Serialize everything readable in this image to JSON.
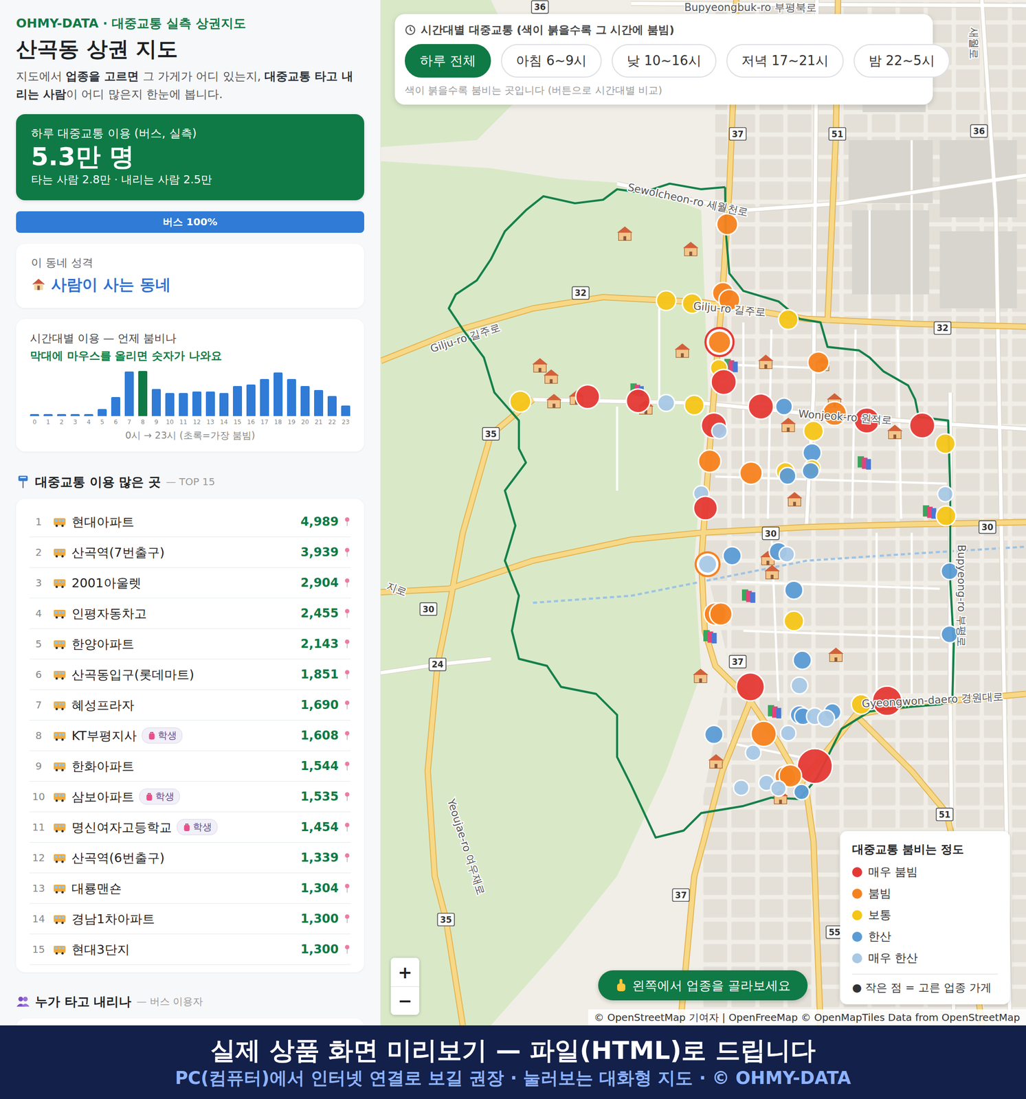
{
  "sidebar": {
    "brand": "OHMY-DATA · 대중교통 실측 상권지도",
    "title": "산곡동 상권 지도",
    "description": [
      {
        "text": "지도에서 ",
        "bold": false
      },
      {
        "text": "업종을 고르면",
        "bold": true
      },
      {
        "text": " 그 가게가 어디 있는지, ",
        "bold": false
      },
      {
        "text": "대중교통 타고 내리는 사람",
        "bold": true
      },
      {
        "text": "이 어디 많은지 한눈에 봅니다.",
        "bold": false
      }
    ],
    "summary": {
      "label": "하루 대중교통 이용 (버스, 실측)",
      "value": "5.3만 명",
      "sub": "타는 사람 2.8만 · 내리는 사람 2.5만"
    },
    "mode_bar": {
      "label": "버스 100%",
      "level": 1
    },
    "character": {
      "label": "이 동네 성격",
      "value": "사람이 사는 동네"
    },
    "chart": {
      "title": "시간대별 이용 — 언제 붐비나",
      "hint": "막대에 마우스를 올리면 숫자가 나와요",
      "labels": [
        "0",
        "1",
        "2",
        "3",
        "4",
        "5",
        "6",
        "7",
        "8",
        "9",
        "10",
        "11",
        "12",
        "13",
        "14",
        "15",
        "16",
        "17",
        "18",
        "19",
        "20",
        "21",
        "22",
        "23"
      ],
      "values": [
        200,
        200,
        200,
        200,
        200,
        700,
        1860,
        4420,
        4450,
        2690,
        2280,
        2280,
        2420,
        2420,
        2280,
        2970,
        3110,
        3660,
        4280,
        3660,
        2970,
        2550,
        2000,
        1040
      ],
      "highlight": 8,
      "caption": "0시 → 23시 (초록=가장 붐빔)"
    },
    "top_list": {
      "title": "대중교통 이용 많은 곳",
      "subtitle": "— TOP 15",
      "items": [
        {
          "rank": "1",
          "name": "현대아파트",
          "count": "4,989",
          "tag": ""
        },
        {
          "rank": "2",
          "name": "산곡역(7번출구)",
          "count": "3,939",
          "tag": ""
        },
        {
          "rank": "3",
          "name": "2001아울렛",
          "count": "2,904",
          "tag": ""
        },
        {
          "rank": "4",
          "name": "인평자동차고",
          "count": "2,455",
          "tag": ""
        },
        {
          "rank": "5",
          "name": "한양아파트",
          "count": "2,143",
          "tag": ""
        },
        {
          "rank": "6",
          "name": "산곡동입구(롯데마트)",
          "count": "1,851",
          "tag": ""
        },
        {
          "rank": "7",
          "name": "혜성프라자",
          "count": "1,690",
          "tag": ""
        },
        {
          "rank": "8",
          "name": "KT부평지사",
          "count": "1,608",
          "tag": "학생"
        },
        {
          "rank": "9",
          "name": "한화아파트",
          "count": "1,544",
          "tag": ""
        },
        {
          "rank": "10",
          "name": "삼보아파트",
          "count": "1,535",
          "tag": "학생"
        },
        {
          "rank": "11",
          "name": "명신여자고등학교",
          "count": "1,454",
          "tag": "학생"
        },
        {
          "rank": "12",
          "name": "산곡역(6번출구)",
          "count": "1,339",
          "tag": ""
        },
        {
          "rank": "13",
          "name": "대룡맨숀",
          "count": "1,304",
          "tag": ""
        },
        {
          "rank": "14",
          "name": "경남1차아파트",
          "count": "1,300",
          "tag": ""
        },
        {
          "rank": "15",
          "name": "현대3단지",
          "count": "1,300",
          "tag": ""
        }
      ]
    },
    "next_section": {
      "title": "누가 타고 내리나",
      "subtitle": "— 버스 이용자"
    }
  },
  "time_filter": {
    "title": "시간대별 대중교통 (색이 붉을수록 그 시간에 붐빔)",
    "hint": "색이 붉을수록 붐비는 곳입니다 (버튼으로 시간대별 비교)",
    "options": [
      {
        "label": "하루 전체",
        "selected": true
      },
      {
        "label": "아침 6~9시",
        "selected": false
      },
      {
        "label": "낮 10~16시",
        "selected": false
      },
      {
        "label": "저녁 17~21시",
        "selected": false
      },
      {
        "label": "밤 22~5시",
        "selected": false
      }
    ]
  },
  "legend": {
    "title": "대중교통 붐비는 정도",
    "items": [
      {
        "label": "매우 붐빔",
        "color": "#e53935"
      },
      {
        "label": "붐빔",
        "color": "#f5821f"
      },
      {
        "label": "보통",
        "color": "#f5c518"
      },
      {
        "label": "한산",
        "color": "#5b9bd5"
      },
      {
        "label": "매우 한산",
        "color": "#a8c8e6"
      }
    ],
    "note": "● 작은 점 = 고른 업종 가게"
  },
  "zoom": {
    "in": "+",
    "out": "−"
  },
  "prompt": "왼쪽에서 업종을 골라보세요",
  "attribution": "© OpenStreetMap 기여자 | OpenFreeMap © OpenMapTiles Data from OpenStreetMap",
  "map": {
    "road_labels": [
      "Bupyeongbuk-ro 부평북로",
      "Sewolcheon-ro 세월천로",
      "Gilju-ro 길주로",
      "Gilju-ro 길주로",
      "Wonjeok-ro 원적로",
      "Gyeongwon-daero 경원대로",
      "Yeoujae-ro 여우재로",
      "Bupyeong-ro 부평로",
      "지로",
      "새월로"
    ],
    "shields": [
      "36",
      "36",
      "37",
      "51",
      "32",
      "32",
      "35",
      "30",
      "30",
      "30",
      "24",
      "37",
      "37",
      "35",
      "51",
      "55"
    ],
    "stops": [
      {
        "color": "#f5821f"
      },
      {
        "color": "#f5821f"
      },
      {
        "color": "#f5821f"
      },
      {
        "color": "#f5c518"
      },
      {
        "color": "#f5c518"
      },
      {
        "color": "#f5c518"
      },
      {
        "color": "#f5821f",
        "ring": "#e53935"
      },
      {
        "color": "#f5c518"
      },
      {
        "color": "#e53935"
      },
      {
        "color": "#e53935"
      },
      {
        "color": "#e53935"
      },
      {
        "color": "#f5c518"
      },
      {
        "color": "#a8c8e6"
      },
      {
        "color": "#f5c518"
      },
      {
        "color": "#e53935"
      },
      {
        "color": "#5b9bd5"
      },
      {
        "color": "#f5821f"
      },
      {
        "color": "#f5821f"
      },
      {
        "color": "#e53935"
      },
      {
        "color": "#e53935"
      },
      {
        "color": "#e53935"
      },
      {
        "color": "#a8c8e6"
      },
      {
        "color": "#f5c518"
      },
      {
        "color": "#f5c518"
      },
      {
        "color": "#5b9bd5"
      },
      {
        "color": "#f5821f"
      },
      {
        "color": "#f5821f"
      },
      {
        "color": "#f5c518"
      },
      {
        "color": "#5b9bd5"
      },
      {
        "color": "#f5c518"
      },
      {
        "color": "#5b9bd5"
      },
      {
        "color": "#a8c8e6"
      },
      {
        "color": "#a8c8e6"
      },
      {
        "color": "#e53935"
      },
      {
        "color": "#f5c518"
      },
      {
        "color": "#5b9bd5"
      },
      {
        "color": "#a8c8e6"
      },
      {
        "color": "#5b9bd5"
      },
      {
        "color": "#a8c8e6",
        "ring": "#f5821f"
      },
      {
        "color": "#5b9bd5"
      },
      {
        "color": "#5b9bd5"
      },
      {
        "color": "#5b9bd5"
      },
      {
        "color": "#f5821f"
      },
      {
        "color": "#f5821f"
      },
      {
        "color": "#f5c518"
      },
      {
        "color": "#5b9bd5"
      },
      {
        "color": "#a8c8e6"
      },
      {
        "color": "#e53935"
      },
      {
        "color": "#f5c518"
      },
      {
        "color": "#e53935"
      },
      {
        "color": "#5b9bd5"
      },
      {
        "color": "#5b9bd5"
      },
      {
        "color": "#5b9bd5"
      },
      {
        "color": "#a8c8e6"
      },
      {
        "color": "#a8c8e6"
      },
      {
        "color": "#5b9bd5"
      },
      {
        "color": "#f5821f"
      },
      {
        "color": "#a8c8e6"
      },
      {
        "color": "#a8c8e6"
      },
      {
        "color": "#e53935"
      },
      {
        "color": "#f5821f"
      },
      {
        "color": "#f5821f"
      },
      {
        "color": "#a8c8e6"
      },
      {
        "color": "#a8c8e6"
      },
      {
        "color": "#5b9bd5"
      },
      {
        "color": "#a8c8e6"
      }
    ]
  },
  "banner": {
    "title": "실제 상품 화면 미리보기 — 파일(HTML)로 드립니다",
    "subtitle": "PC(컴퓨터)에서 인터넷 연결로 보길 권장 · 눌러보는 대화형 지도 · © OHMY-DATA"
  }
}
